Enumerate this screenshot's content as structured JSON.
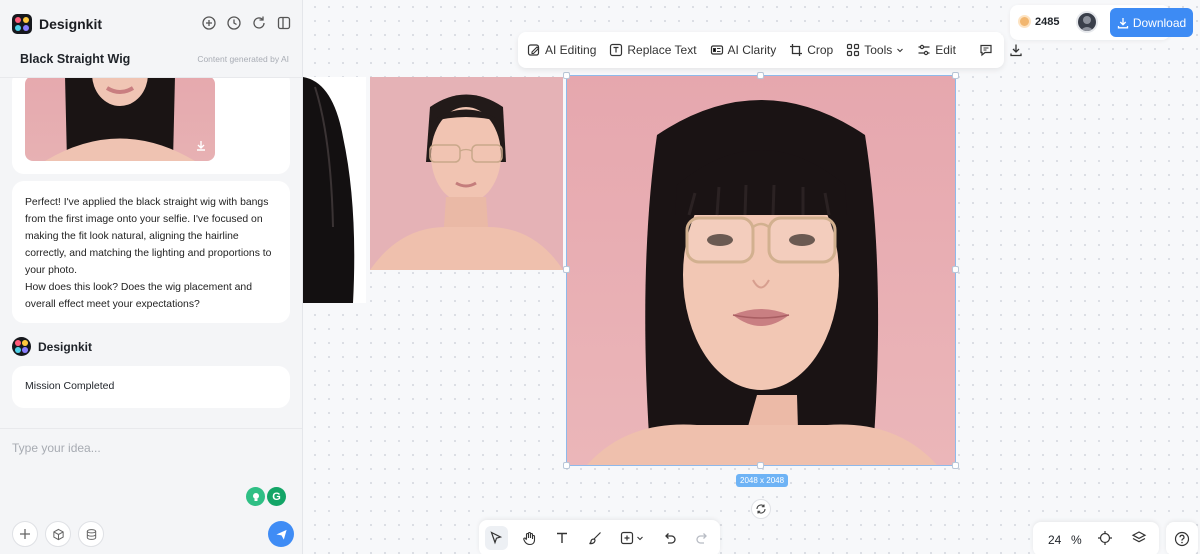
{
  "app": {
    "name": "Designkit"
  },
  "chat": {
    "title": "Black Straight Wig",
    "ai_note": "Content generated by AI",
    "assistant_message": "Perfect! I've applied the black straight wig with bangs from the first image onto your selfie. I've focused on making the fit look natural, aligning the hairline correctly, and matching the lighting and proportions to your photo.\nHow does this look? Does the wig placement and overall effect meet your expectations?",
    "bot_name": "Designkit",
    "status": "Mission Completed",
    "input_placeholder": "Type your idea..."
  },
  "toolbar": {
    "ai_editing": "AI Editing",
    "replace_text": "Replace Text",
    "ai_clarity": "AI Clarity",
    "crop": "Crop",
    "tools": "Tools",
    "edit": "Edit"
  },
  "account": {
    "credits": "2485",
    "download_label": "Download"
  },
  "canvas": {
    "dimension_label": "2048 x 2048",
    "zoom": "24",
    "zoom_unit": "%"
  },
  "colors": {
    "accent": "#3d8bf4",
    "background": "#f7f8fa",
    "selection": "#8fb9ea"
  },
  "icons": {
    "header": [
      "new-chat-icon",
      "history-icon",
      "refresh-icon",
      "sidebar-collapse-icon"
    ],
    "bottom": [
      "select-icon",
      "hand-icon",
      "text-icon",
      "brush-icon",
      "add-shape-icon",
      "undo-icon",
      "redo-icon"
    ]
  }
}
